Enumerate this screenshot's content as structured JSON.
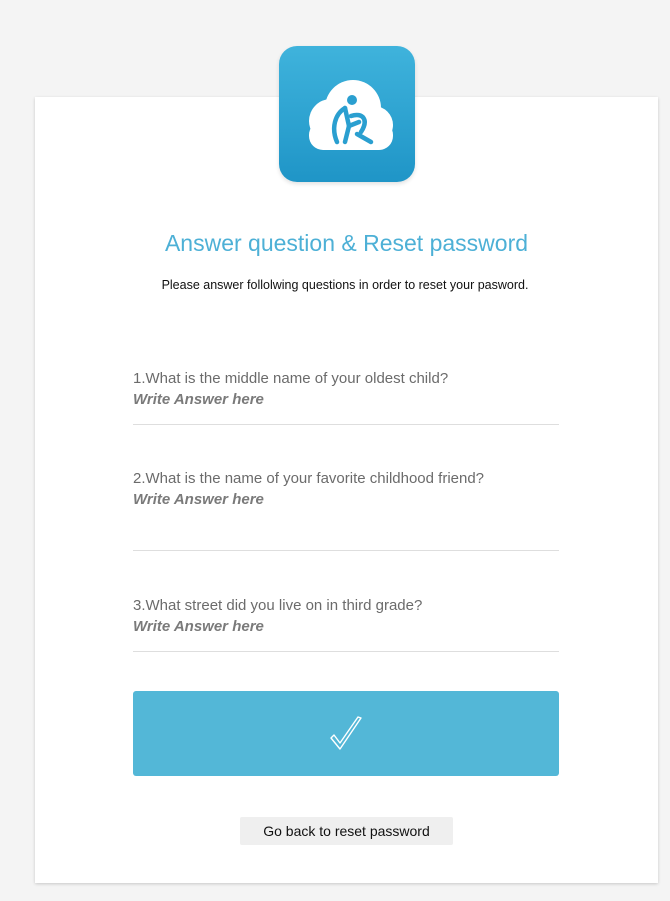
{
  "logo": {
    "icon": "cloud-app-logo",
    "color": "#2aa3d4"
  },
  "title": "Answer question & Reset password",
  "subtitle": "Please answer follolwing questions in order to reset your pasword.",
  "questions": [
    {
      "label": "1.What is the middle name of your oldest child?",
      "placeholder": "Write Answer here",
      "value": ""
    },
    {
      "label": "2.What is the name of your favorite childhood friend?",
      "placeholder": "Write Answer here",
      "value": ""
    },
    {
      "label": "3.What street did you live on in third grade?",
      "placeholder": "Write Answer here",
      "value": ""
    }
  ],
  "submit": {
    "icon": "checkmark-icon",
    "color": "#53b7d7"
  },
  "back_link": "Go back to reset password"
}
